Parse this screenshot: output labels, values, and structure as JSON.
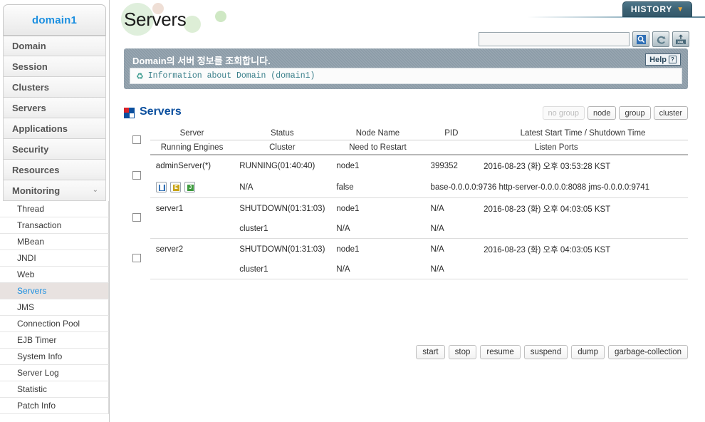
{
  "sidebar": {
    "domain_label": "domain1",
    "top_items": [
      {
        "label": "Domain"
      },
      {
        "label": "Session"
      },
      {
        "label": "Clusters"
      },
      {
        "label": "Servers"
      },
      {
        "label": "Applications"
      },
      {
        "label": "Security"
      },
      {
        "label": "Resources"
      },
      {
        "label": "Monitoring",
        "expanded": true,
        "chevron": "⌄"
      }
    ],
    "sub_items": [
      {
        "label": "Thread"
      },
      {
        "label": "Transaction"
      },
      {
        "label": "MBean"
      },
      {
        "label": "JNDI"
      },
      {
        "label": "Web"
      },
      {
        "label": "Servers",
        "active": true
      },
      {
        "label": "JMS"
      },
      {
        "label": "Connection Pool"
      },
      {
        "label": "EJB Timer"
      },
      {
        "label": "System Info"
      },
      {
        "label": "Server Log"
      },
      {
        "label": "Statistic"
      },
      {
        "label": "Patch Info"
      }
    ]
  },
  "header": {
    "page_title": "Servers",
    "history_label": "HISTORY",
    "history_caret": "▼"
  },
  "search": {
    "value": "",
    "placeholder": "",
    "icons": [
      "search-icon",
      "refresh-icon",
      "xml-export-icon"
    ]
  },
  "banner": {
    "title": "Domain의 서버 정보를 조회합니다.",
    "help_label": "Help",
    "help_mark": "?",
    "info_text": "Information about Domain (domain1)",
    "info_icon": "♻"
  },
  "section": {
    "title": "Servers",
    "group_buttons": [
      {
        "label": "no group",
        "disabled": true
      },
      {
        "label": "node",
        "disabled": false
      },
      {
        "label": "group",
        "disabled": false
      },
      {
        "label": "cluster",
        "disabled": false
      }
    ]
  },
  "table": {
    "headers_row1": [
      "Server",
      "Status",
      "Node Name",
      "PID",
      "Latest Start Time / Shutdown Time"
    ],
    "headers_row2": [
      "Running Engines",
      "Cluster",
      "Need to Restart",
      "Listen Ports"
    ],
    "rows": [
      {
        "server": "adminServer(*)",
        "status": "RUNNING(01:40:40)",
        "node_name": "node1",
        "pid": "399352",
        "time": "2016-08-23 (화) 오후 03:53:28 KST",
        "engines": [
          {
            "name": "web-engine-icon",
            "letter": "█"
          },
          {
            "name": "ejb-engine-icon",
            "letter": "E"
          },
          {
            "name": "jms-engine-icon",
            "letter": "J"
          }
        ],
        "cluster": "N/A",
        "need_restart": "false",
        "listen_ports": "base-0.0.0.0:9736  http-server-0.0.0.0:8088  jms-0.0.0.0:9741"
      },
      {
        "server": "server1",
        "status": "SHUTDOWN(01:31:03)",
        "node_name": "node1",
        "pid": "N/A",
        "time": "2016-08-23 (화) 오후 04:03:05 KST",
        "engines": [],
        "cluster": "cluster1",
        "need_restart": "N/A",
        "listen_ports": "N/A"
      },
      {
        "server": "server2",
        "status": "SHUTDOWN(01:31:03)",
        "node_name": "node1",
        "pid": "N/A",
        "time": "2016-08-23 (화) 오후 04:03:05 KST",
        "engines": [],
        "cluster": "cluster1",
        "need_restart": "N/A",
        "listen_ports": "N/A"
      }
    ]
  },
  "actions": [
    {
      "label": "start"
    },
    {
      "label": "stop"
    },
    {
      "label": "resume"
    },
    {
      "label": "suspend"
    },
    {
      "label": "dump"
    },
    {
      "label": "garbage-collection"
    }
  ],
  "colors": {
    "accent_blue": "#1b8fe0",
    "section_blue": "#0b4f9e",
    "banner_gray": "#8a9aa6",
    "history_teal": "#3c6274",
    "history_caret": "#f0a93a"
  }
}
